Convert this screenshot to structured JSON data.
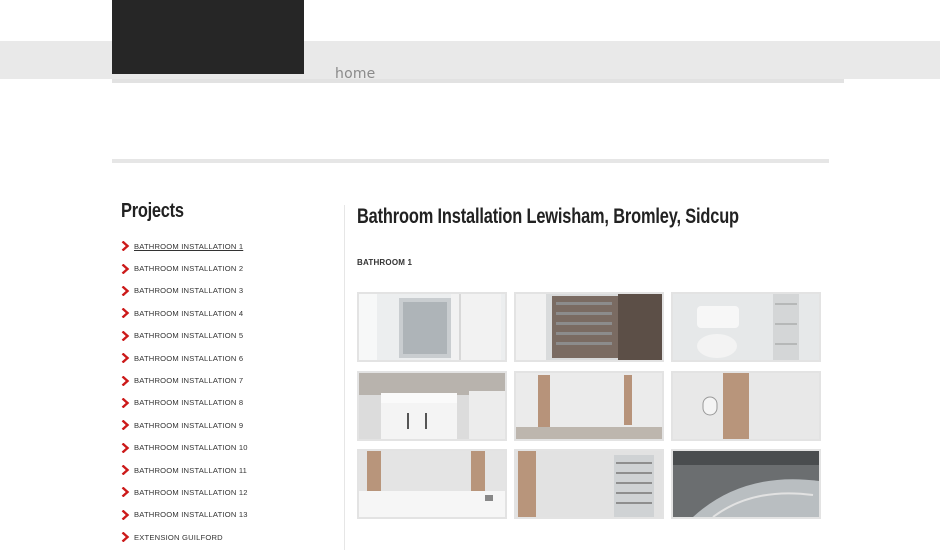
{
  "header": {
    "nav_home": "home"
  },
  "sidebar": {
    "title": "Projects",
    "items": [
      "BATHROOM INSTALLATION 1",
      "BATHROOM INSTALLATION 2",
      "BATHROOM INSTALLATION 3",
      "BATHROOM INSTALLATION 4",
      "BATHROOM INSTALLATION 5",
      "BATHROOM INSTALLATION 6",
      "BATHROOM INSTALLATION 7",
      "BATHROOM INSTALLATION 8",
      "BATHROOM INSTALLATION 9",
      "BATHROOM INSTALLATION 10",
      "BATHROOM INSTALLATION 11",
      "BATHROOM INSTALLATION 12",
      "BATHROOM INSTALLATION 13",
      "EXTENSION GUILFORD"
    ],
    "active_index": 0,
    "bullet_color": "#cc1a1a"
  },
  "main": {
    "title": "Bathroom Installation Lewisham, Bromley, Sidcup",
    "subheading": "BATHROOM 1",
    "gallery_count": 9
  },
  "colors": {
    "logo": "#262626",
    "band": "#e9e9e9",
    "accent": "#cc1a1a"
  }
}
